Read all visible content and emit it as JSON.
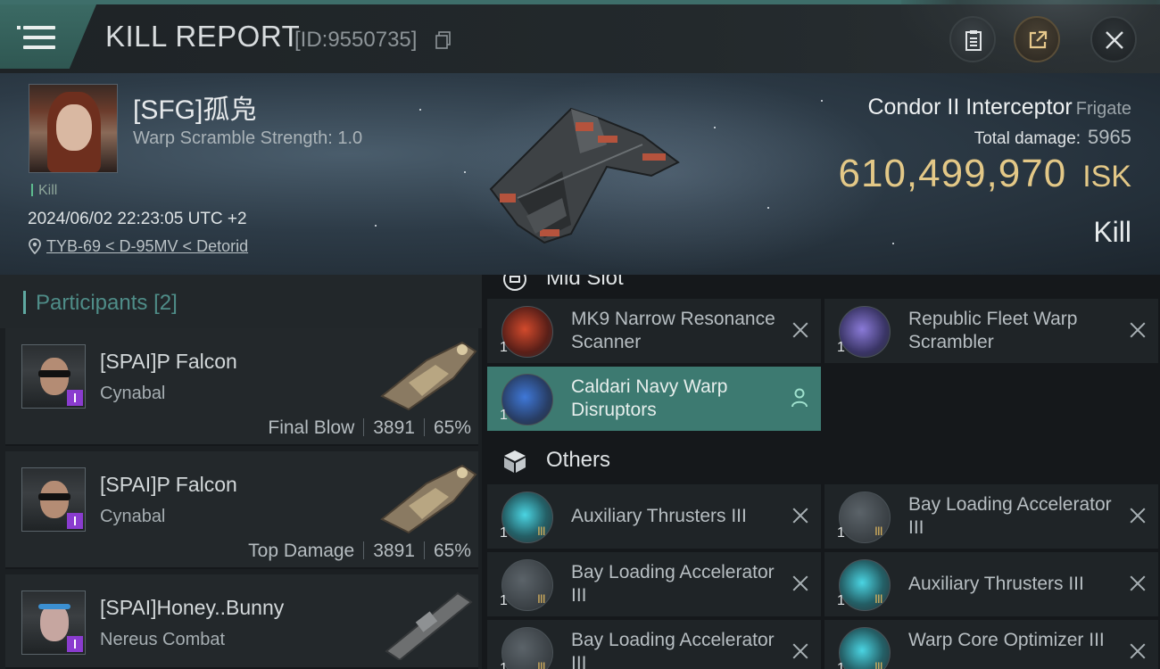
{
  "header": {
    "title": "KILL REPORT",
    "report_id": "[ID:9550735]",
    "icons": [
      "menu-icon",
      "copy-icon",
      "clipboard-icon",
      "share-icon",
      "close-icon"
    ]
  },
  "victim": {
    "name": "[SFG]孤凫",
    "warp_scramble": "Warp Scramble Strength: 1.0",
    "tag": "Kill",
    "datetime": "2024/06/02 22:23:05 UTC +2",
    "location": "TYB-69 < D-95MV < Detorid",
    "ship_name": "Condor II Interceptor",
    "ship_class": "Frigate",
    "total_damage_label": "Total damage:",
    "total_damage": "5965",
    "isk_value": "610,499,970",
    "isk_unit": "ISK",
    "result": "Kill"
  },
  "participants": {
    "label": "Participants",
    "count": "[2]",
    "rows": [
      {
        "name": "[SPAI]P Falcon",
        "ship": "Cynabal",
        "role": "Final Blow",
        "damage": "3891",
        "percent": "65%"
      },
      {
        "name": "[SPAI]P Falcon",
        "ship": "Cynabal",
        "role": "Top Damage",
        "damage": "3891",
        "percent": "65%"
      },
      {
        "name": "[SPAI]Honey..Bunny",
        "ship": "Nereus Combat"
      }
    ]
  },
  "fitting": {
    "mid_slot_label": "Mid Slot",
    "others_label": "Others",
    "mid_slots": [
      {
        "name": "MK9 Narrow Resonance Scanner",
        "qty": "1",
        "status": "destroyed"
      },
      {
        "name": "Republic Fleet Warp Scrambler",
        "qty": "1",
        "status": "destroyed"
      },
      {
        "name": "Caldari Navy Warp Disruptors",
        "qty": "1",
        "status": "dropped"
      }
    ],
    "others": [
      {
        "name": "Auxiliary Thrusters III",
        "qty": "1",
        "tier": "III"
      },
      {
        "name": "Bay Loading Accelerator III",
        "qty": "1",
        "tier": "III"
      },
      {
        "name": "Bay Loading Accelerator III",
        "qty": "1",
        "tier": "III"
      },
      {
        "name": "Auxiliary Thrusters III",
        "qty": "1",
        "tier": "III"
      },
      {
        "name": "Bay Loading Accelerator III",
        "qty": "1",
        "tier": "III"
      },
      {
        "name": "Warp Core Optimizer III",
        "qty": "1",
        "tier": "III"
      }
    ]
  },
  "colors": {
    "accent_teal": "#3d7a71",
    "isk_gold": "#e3c887",
    "tier_gold": "#d8b25d",
    "badge_purple": "#8a3ccf"
  }
}
